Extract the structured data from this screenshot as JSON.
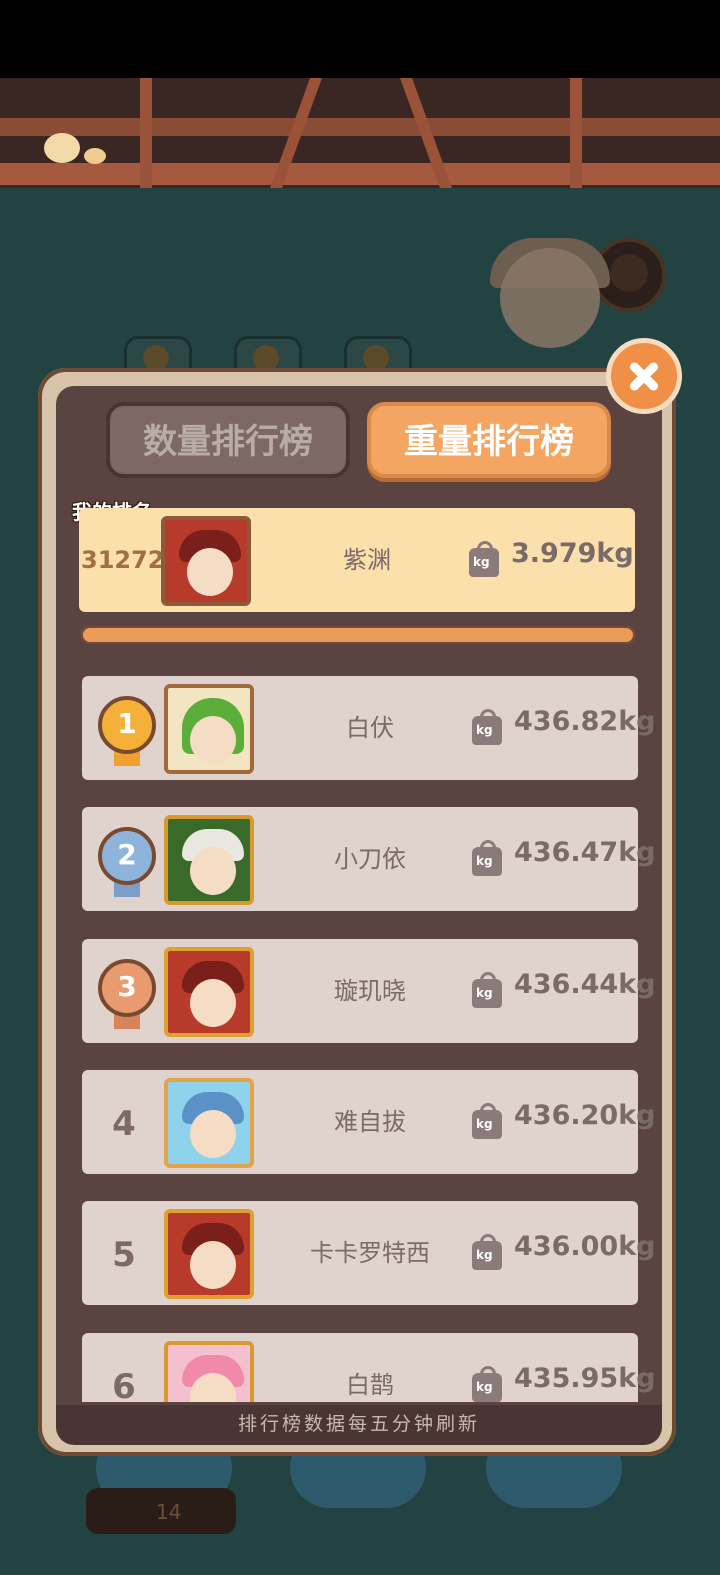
{
  "panel": {
    "tabs": [
      {
        "label": "数量排行榜",
        "active": false
      },
      {
        "label": "重量排行榜",
        "active": true
      }
    ],
    "my_rank_label": "我的排名",
    "my_entry": {
      "rank": "31272",
      "name": "紫渊",
      "weight": "3.979kg"
    },
    "weight_icon_text": "kg",
    "entries": [
      {
        "rank": "1",
        "name": "白伏",
        "weight": "436.82kg",
        "medal": "gold"
      },
      {
        "rank": "2",
        "name": "小刀依",
        "weight": "436.47kg",
        "medal": "silver"
      },
      {
        "rank": "3",
        "name": "璇玑晓",
        "weight": "436.44kg",
        "medal": "bronze"
      },
      {
        "rank": "4",
        "name": "难自拔",
        "weight": "436.20kg"
      },
      {
        "rank": "5",
        "name": "卡卡罗特西",
        "weight": "436.00kg"
      },
      {
        "rank": "6",
        "name": "白鹊",
        "weight": "435.95kg"
      }
    ],
    "footer": "排行榜数据每五分钟刷新"
  },
  "background": {
    "key_count": "14"
  },
  "colors": {
    "accent_orange": "#f3a561",
    "panel_brown": "#5b4342",
    "row_bg": "#e0d3cd",
    "my_row_bg": "#fce0ac"
  }
}
